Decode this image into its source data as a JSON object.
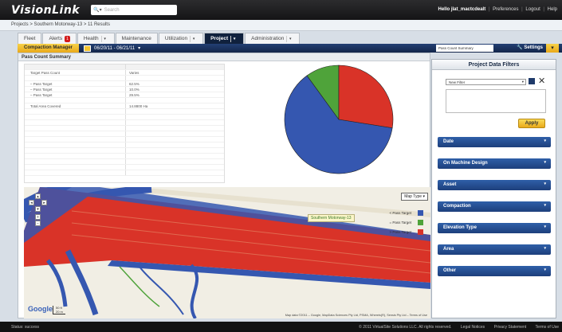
{
  "app": {
    "logo": "VisionLink",
    "logo_tag": ""
  },
  "search": {
    "scope": "▾",
    "placeholder": "Search"
  },
  "header": {
    "greeting": "Hello jlat_mactcdealt",
    "links": [
      "Preferences",
      "Logout",
      "Help"
    ]
  },
  "breadcrumb": "Projects > Southern Motorway-13 > 11 Results",
  "tabs": [
    {
      "label": "Fleet"
    },
    {
      "label": "Alerts",
      "badge": "1"
    },
    {
      "label": "Health"
    },
    {
      "label": "Maintenance"
    },
    {
      "label": "Utilization"
    },
    {
      "label": "Project",
      "active": true
    },
    {
      "label": "Administration"
    }
  ],
  "subbar": {
    "manager": "Compaction Manager",
    "date_range": "06/20/11 - 06/21/11",
    "summary_select": "Pass Count Summary",
    "settings": "Settings"
  },
  "pass_count": {
    "title": "Pass Count Summary",
    "rows": [
      [
        "",
        ""
      ],
      [
        "Target Pass Count",
        "Varies"
      ],
      [
        "",
        ""
      ],
      [
        "– Pass Target",
        "62.5%"
      ],
      [
        "– Pass Target",
        "10.0%"
      ],
      [
        "– Pass Target",
        "29.5%"
      ],
      [
        "",
        ""
      ],
      [
        "Total Area Covered",
        "14.8800 Ha"
      ],
      [
        "",
        ""
      ],
      [
        "",
        ""
      ],
      [
        "",
        ""
      ],
      [
        "",
        ""
      ],
      [
        "",
        ""
      ],
      [
        "",
        ""
      ],
      [
        "",
        ""
      ],
      [
        "",
        ""
      ],
      [
        "",
        ""
      ],
      [
        "",
        ""
      ],
      [
        "",
        ""
      ],
      [
        "",
        ""
      ]
    ]
  },
  "chart_data": {
    "type": "pie",
    "categories": [
      "< Pass Target",
      "= Pass Target",
      "> Pass Target"
    ],
    "values": [
      62.5,
      10.0,
      27.5
    ],
    "colors": [
      "#3557b0",
      "#4fa33a",
      "#d93328"
    ]
  },
  "map": {
    "map_type": "Map Type",
    "label": "Southern Motorway-13",
    "legend": [
      {
        "label": "< Pass Target",
        "color": "#3557b0"
      },
      {
        "label": "= Pass Target",
        "color": "#4fa33a"
      },
      {
        "label": "> Pass Target",
        "color": "#d93328"
      }
    ],
    "google": "Google",
    "scale_top": "50 ft",
    "scale_bottom": "20 m",
    "attribution": "Map data ©2011 – Google, MapData Sciences Pty Ltd, PSMA, Whereis(R), Sensis Pty Ltd – Terms of Use"
  },
  "filters": {
    "title": "Project Data Filters",
    "new_filter": "New Filter",
    "apply": "Apply",
    "sections": [
      "Date",
      "On Machine Design",
      "Asset",
      "Compaction",
      "Elevation Type",
      "Area",
      "Other"
    ]
  },
  "status": {
    "left": "Status: success",
    "right": [
      "© 2011 VirtualSite Solutions LLC. All rights reserved.",
      "Legal Notices",
      "Privacy Statement",
      "Terms of Use"
    ]
  }
}
